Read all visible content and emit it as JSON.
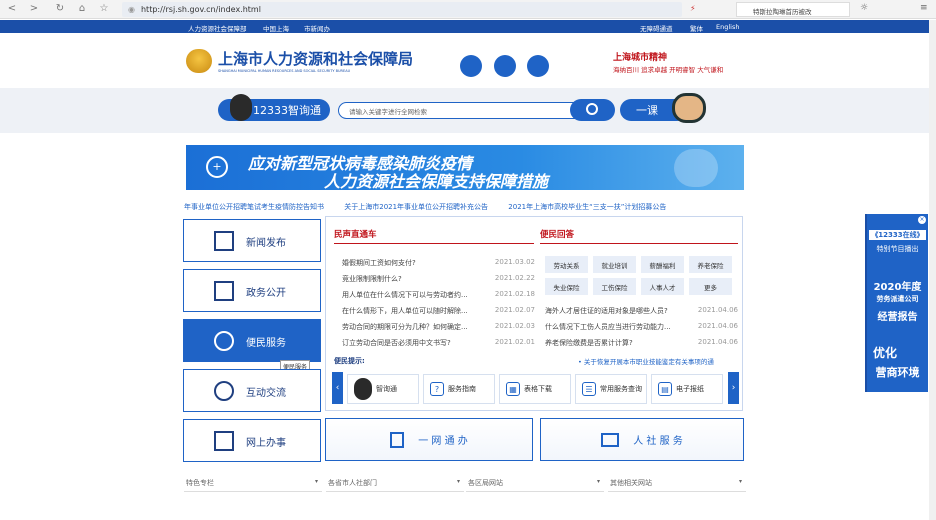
{
  "browser": {
    "url": "http://rsj.sh.gov.cn/index.html",
    "right_text": "特斯拉陶琳首历被改",
    "nav": [
      "<",
      ">",
      "C",
      "⌂",
      "☆"
    ]
  },
  "topstrip": {
    "links": [
      "人力资源社会保障部",
      "中国上海",
      "市新闻办"
    ],
    "right": [
      "无障碍通道",
      "繁体",
      "English"
    ]
  },
  "header": {
    "title": "上海市人力资源和社会保障局",
    "subtitle": "SHANGHAI MUNICIPAL HUMAN RESOURCES AND SOCIAL SECURITY BUREAU",
    "spirit_title": "上海城市精神",
    "spirit_text": "海纳百川 追求卓越 开明睿智 大气谦和"
  },
  "search": {
    "left_button": "12333智询通",
    "placeholder": "请输入关键字进行全网检索",
    "right_button": "一课"
  },
  "banner": {
    "line1": "应对新型冠状病毒感染肺炎疫情",
    "line2": "人力资源社会保障支持保障措施"
  },
  "ticker": [
    "年事业单位公开招聘笔试考生疫情防控告知书",
    "关于上海市2021年事业单位公开招聘补充公告",
    "2021年上海市高校毕业生“三支一扶”计划招募公告"
  ],
  "side_menu": [
    {
      "label": "新闻发布",
      "icon": "newspaper-icon"
    },
    {
      "label": "政务公开",
      "icon": "document-icon"
    },
    {
      "label": "便民服务",
      "icon": "people-icon",
      "tooltip": "便民服务"
    },
    {
      "label": "互动交流",
      "icon": "chat-icon"
    },
    {
      "label": "网上办事",
      "icon": "monitor-icon"
    }
  ],
  "direct": {
    "title": "民声直通车",
    "items": [
      {
        "text": "婚假期间工资如何支付?",
        "date": "2021.03.02"
      },
      {
        "text": "竞业限制限制什么?",
        "date": "2021.02.22"
      },
      {
        "text": "用人单位在什么情况下可以与劳动者约...",
        "date": "2021.02.18"
      },
      {
        "text": "在什么情形下，用人单位可以随时解除...",
        "date": "2021.02.07"
      },
      {
        "text": "劳动合同的期限可分为几种？如何确定...",
        "date": "2021.02.03"
      },
      {
        "text": "订立劳动合同是否必须用中文书写?",
        "date": "2021.02.01"
      }
    ]
  },
  "answers": {
    "title": "便民回答",
    "tags": [
      "劳动关系",
      "就业培训",
      "薪酬福利",
      "养老保险",
      "失业保险",
      "工伤保险",
      "人事人才",
      "更多"
    ],
    "items": [
      {
        "text": "海外人才居住证的适用对象是哪些人员?",
        "date": "2021.04.06"
      },
      {
        "text": "什么情况下工伤人员应当进行劳动能力...",
        "date": "2021.04.06"
      },
      {
        "text": "养老保险缴费是否累计计算?",
        "date": "2021.04.06"
      }
    ]
  },
  "tips": {
    "label": "便民提示:",
    "text": "• 关于恢复开展本市职业技能鉴定有关事项的通"
  },
  "services": [
    "智询通",
    "服务指南",
    "表格下载",
    "常用服务查询",
    "电子报纸"
  ],
  "online": {
    "box1": "一 网 通 办",
    "box2": "人 社 服 务"
  },
  "selects": [
    "特色专栏",
    "各省市人社部门",
    "各区局网站",
    "其他相关网站"
  ],
  "right_ad": {
    "top": "《12333在线》",
    "top2": "特别节目播出",
    "mid1": "2020年度",
    "mid2": "劳务派遣公司",
    "mid3": "经营报告",
    "bottom1": "优化",
    "bottom2": "营商环境"
  },
  "colors": {
    "primary": "#1f63c6",
    "accent": "#c0141b"
  }
}
